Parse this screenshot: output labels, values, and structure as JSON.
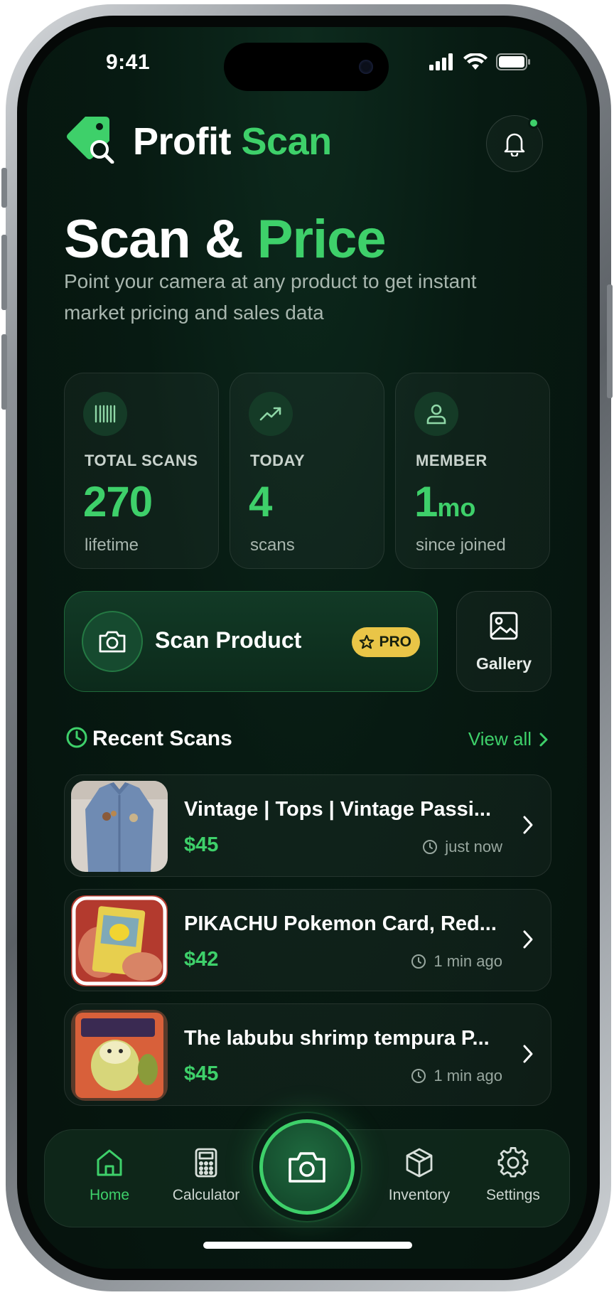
{
  "status_bar": {
    "time": "9:41"
  },
  "header": {
    "brand_primary": "Profit",
    "brand_accent": "Scan"
  },
  "hero": {
    "title_primary": "Scan &",
    "title_accent": "Price",
    "subtitle": "Point your camera at any product to get instant market pricing and sales data"
  },
  "stats": [
    {
      "label": "TOTAL SCANS",
      "value": "270",
      "unit": "",
      "sub": "lifetime",
      "icon": "barcode-icon"
    },
    {
      "label": "TODAY",
      "value": "4",
      "unit": "",
      "sub": "scans",
      "icon": "trending-up-icon"
    },
    {
      "label": "MEMBER",
      "value": "1",
      "unit": "mo",
      "sub": "since joined",
      "icon": "user-icon"
    }
  ],
  "actions": {
    "scan_label": "Scan Product",
    "pro_badge": "PRO",
    "gallery_label": "Gallery"
  },
  "recent": {
    "title": "Recent Scans",
    "view_all": "View all",
    "items": [
      {
        "title": "Vintage | Tops | Vintage Passi...",
        "price": "$45",
        "time": "just now"
      },
      {
        "title": "PIKACHU Pokemon Card, Red...",
        "price": "$42",
        "time": "1 min ago"
      },
      {
        "title": "The labubu shrimp tempura P...",
        "price": "$45",
        "time": "1 min ago"
      }
    ]
  },
  "nav": {
    "items": [
      {
        "label": "Home",
        "icon": "home-icon",
        "active": true
      },
      {
        "label": "Calculator",
        "icon": "calculator-icon",
        "active": false
      },
      {
        "label": "Inventory",
        "icon": "box-icon",
        "active": false
      },
      {
        "label": "Settings",
        "icon": "gear-icon",
        "active": false
      }
    ]
  },
  "colors": {
    "accent": "#3ed06a",
    "background": "#071a12",
    "pro_badge": "#e9c547"
  }
}
